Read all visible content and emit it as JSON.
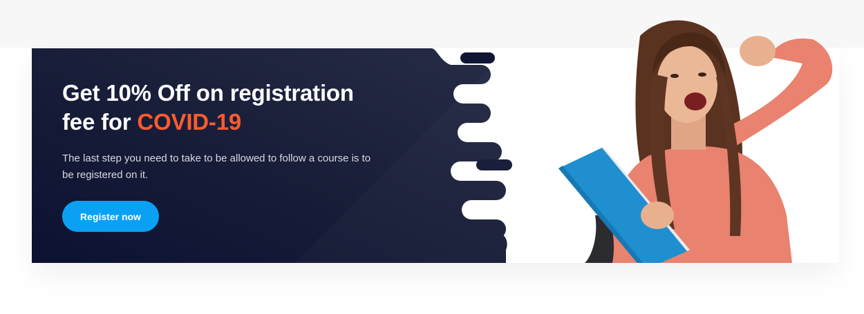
{
  "banner": {
    "headline_part1": "Get 10% Off on registration fee for ",
    "headline_highlight": "COVID-19",
    "description": "The last step you need to take to be allowed to follow a course is to be registered on it.",
    "button_label": "Register now"
  },
  "colors": {
    "panel_dark": "#0e1430",
    "accent_orange": "#ff5b2e",
    "button_blue": "#0aa1f5",
    "top_band": "#f7f7f8"
  },
  "illustration": {
    "description_icon": "student-with-books-illustration"
  }
}
